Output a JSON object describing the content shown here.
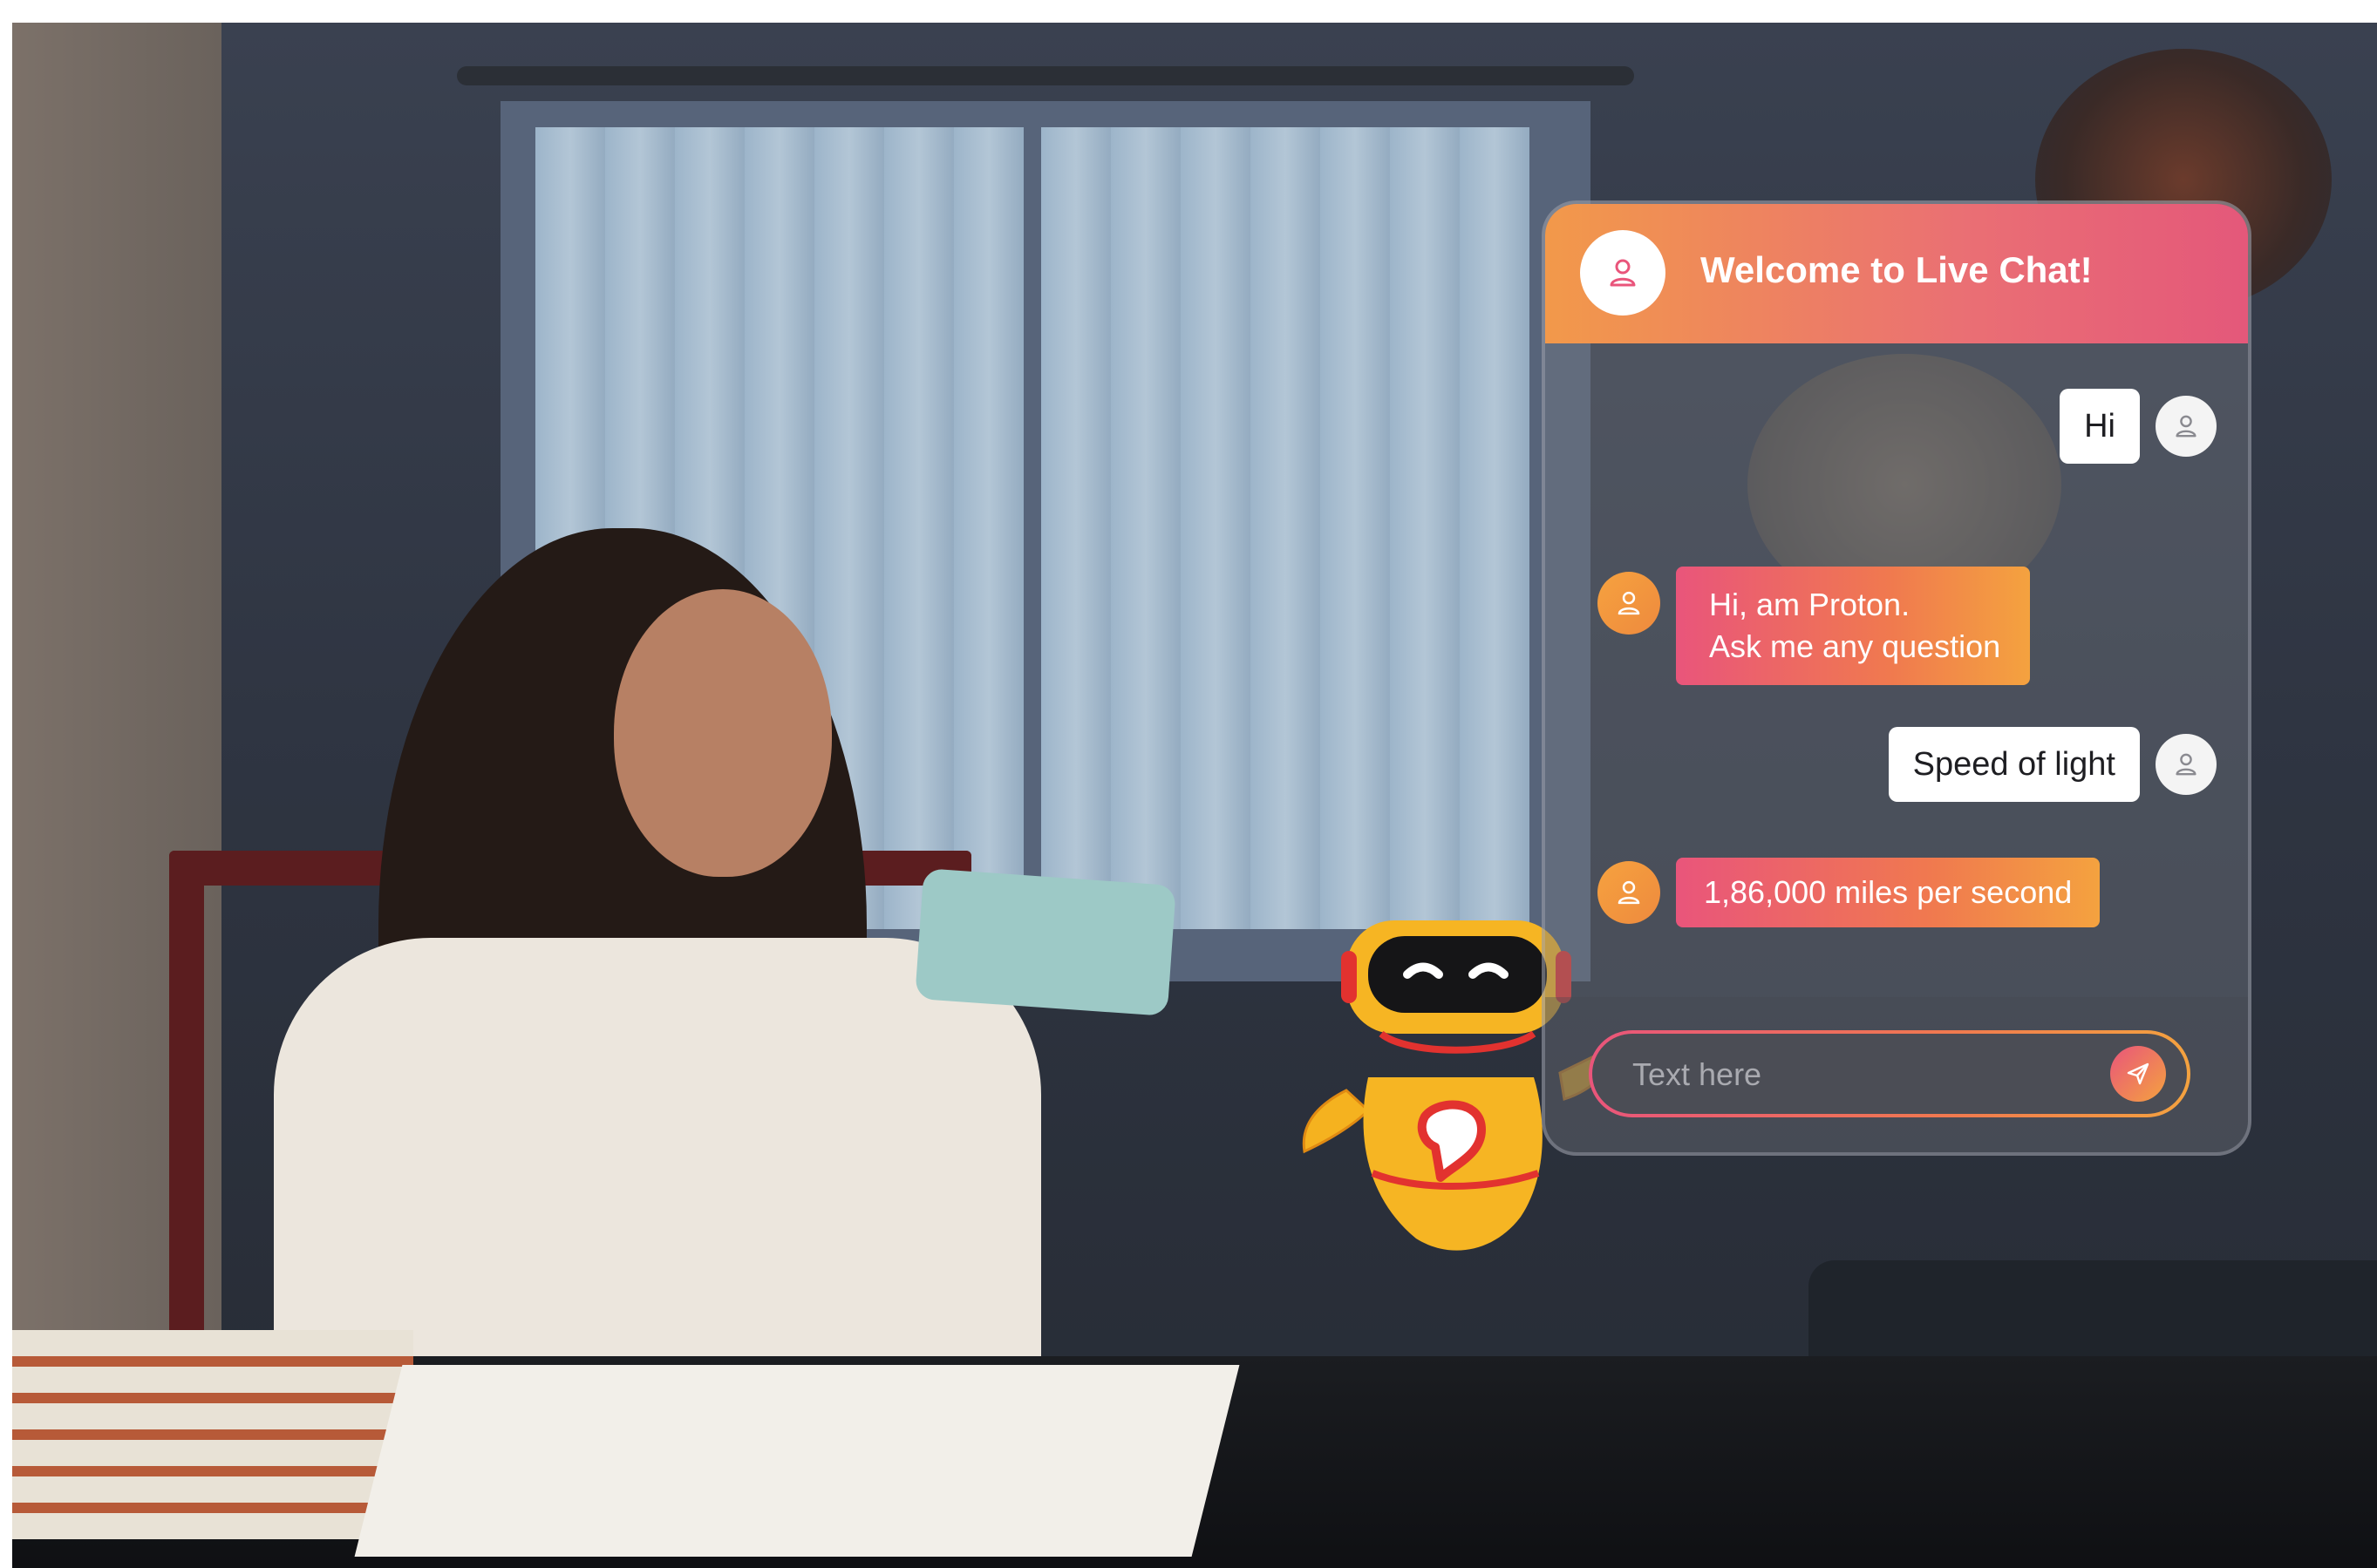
{
  "chat": {
    "title": "Welcome to Live Chat!",
    "messages": [
      {
        "sender": "user",
        "lines": [
          "Hi"
        ]
      },
      {
        "sender": "bot",
        "lines": [
          "Hi, am Proton.",
          "Ask me any question"
        ]
      },
      {
        "sender": "user",
        "lines": [
          "Speed of light"
        ]
      },
      {
        "sender": "bot",
        "lines": [
          "1,86,000 miles per second"
        ]
      }
    ],
    "composer": {
      "placeholder": "Text here"
    }
  },
  "icons": {
    "header_avatar": "user-icon",
    "user_avatar": "user-icon",
    "bot_avatar": "user-icon",
    "send": "paper-plane-icon",
    "mascot": "robot-mascot"
  },
  "colors": {
    "header_gradient_start": "#f2994a",
    "header_gradient_end": "#e4587a",
    "bot_bubble_start": "#e9557b",
    "bot_bubble_end": "#f4a23f",
    "user_bubble": "#ffffff",
    "robot_body": "#f5b21f"
  }
}
